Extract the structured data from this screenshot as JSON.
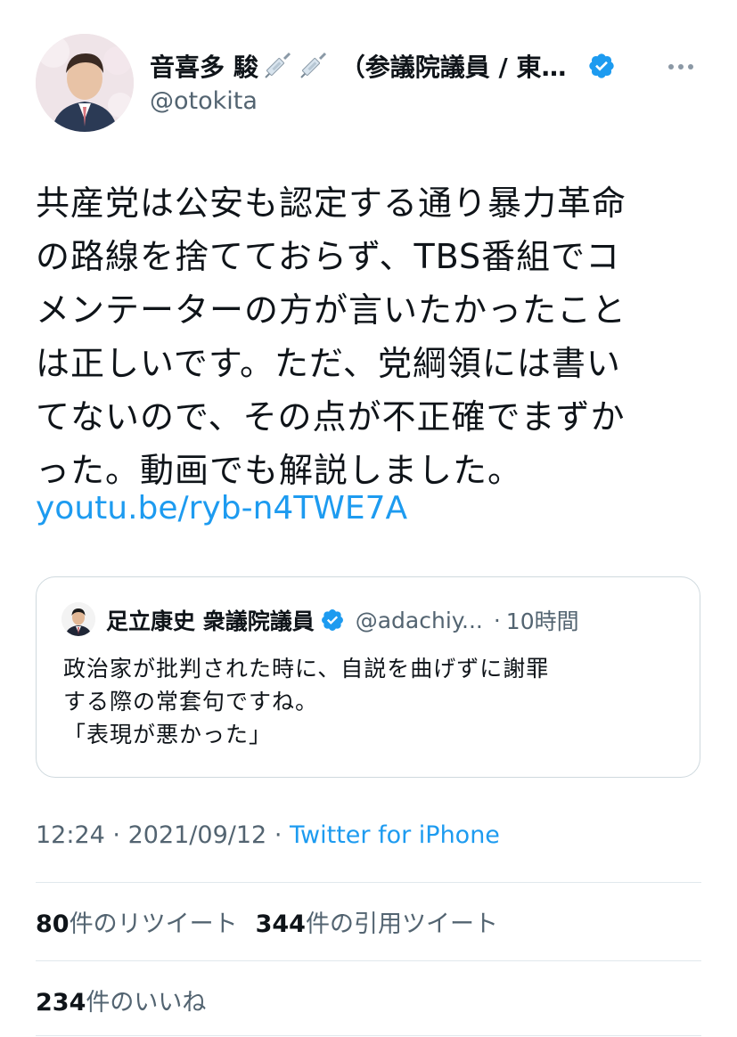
{
  "author": {
    "display_name": "音喜多 駿",
    "affiliation": "（参議院議員 / 東…",
    "handle": "@otokita",
    "icons": [
      "syringe-icon",
      "syringe-icon",
      "verified-badge-icon",
      "more-icon"
    ]
  },
  "tweet": {
    "text_lines": [
      "共産党は公安も認定する通り暴力革命",
      "の路線を捨てておらず、TBS番組でコ",
      "メンテーターの方が言いたかったこと",
      "は正しいです。ただ、党綱領には書い",
      "てないので、その点が不正確でまずか",
      "った。動画でも解説しました。"
    ],
    "link": "youtu.be/ryb-n4TWE7A"
  },
  "quote": {
    "name": "足立康史 衆議院議員",
    "handle": "@adachiy...",
    "separator": "·",
    "time": "10時間",
    "text_lines": [
      "政治家が批判された時に、自説を曲げずに謝罪",
      "する際の常套句ですね。",
      "「表現が悪かった」"
    ]
  },
  "meta": {
    "time": "12:24",
    "dot1": "·",
    "date": "2021/09/12",
    "dot2": "·",
    "source": "Twitter for iPhone"
  },
  "stats": {
    "retweets_count": "80",
    "retweets_label": "件のリツイート",
    "quotes_count": "344",
    "quotes_label": "件の引用ツイート",
    "likes_count": "234",
    "likes_label": "件のいいね"
  },
  "colors": {
    "link": "#1d9bf0",
    "secondary_text": "#536471",
    "border": "#cfd9de"
  }
}
